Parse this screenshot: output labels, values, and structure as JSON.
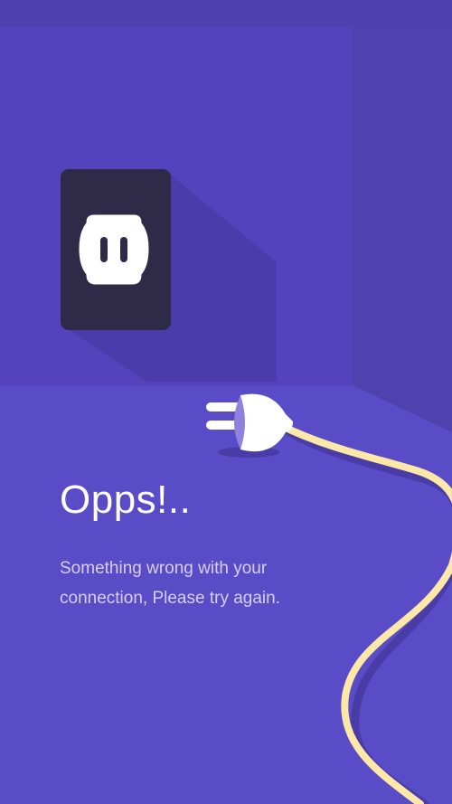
{
  "error": {
    "title": "Opps!..",
    "message": "Something wrong with your connection, Please try again."
  },
  "colors": {
    "background": "#5a4bc6",
    "wall": "#5543bd",
    "wall_side": "#4f41ae",
    "socket": "#2f2a48",
    "plug": "#ffffff",
    "cable": "#fde8a8"
  },
  "illustration": {
    "socket": "wall-socket-icon",
    "plug": "unplugged-plug-icon",
    "cable": "cable-icon"
  }
}
